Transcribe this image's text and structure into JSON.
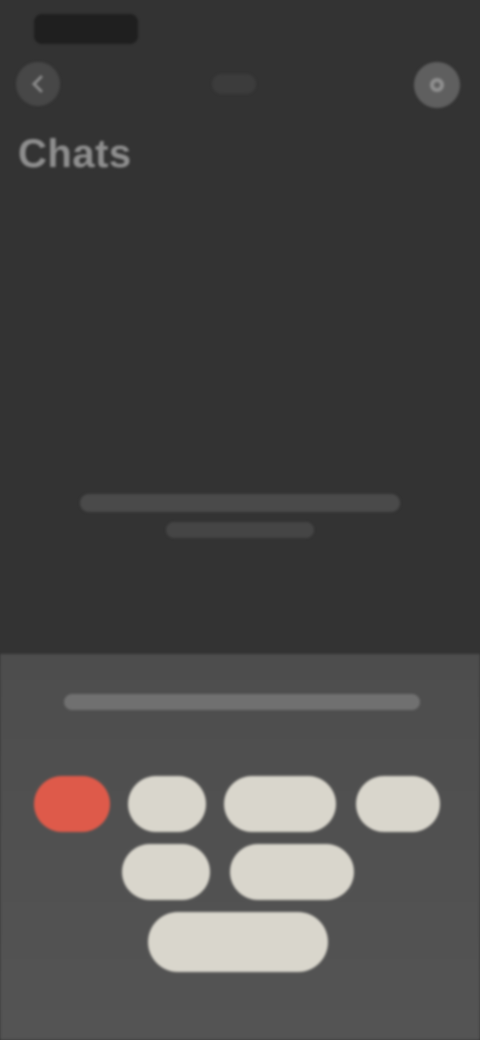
{
  "status_bar": {
    "time": ""
  },
  "top_bar": {
    "center_label": ""
  },
  "page": {
    "title": "Chats"
  },
  "empty_state": {
    "line1": "",
    "line2": ""
  },
  "panel": {
    "prompt": "",
    "chips": [
      {
        "label": "",
        "selected": true
      },
      {
        "label": "",
        "selected": false
      },
      {
        "label": "",
        "selected": false
      },
      {
        "label": "",
        "selected": false
      },
      {
        "label": "",
        "selected": false
      },
      {
        "label": "",
        "selected": false
      },
      {
        "label": "",
        "selected": false
      }
    ]
  },
  "colors": {
    "background": "#333333",
    "panel": "#505050",
    "chip": "#d9d6cc",
    "chip_selected": "#de5a4a"
  },
  "icons": {
    "back": "back-icon",
    "settings": "settings-icon"
  }
}
